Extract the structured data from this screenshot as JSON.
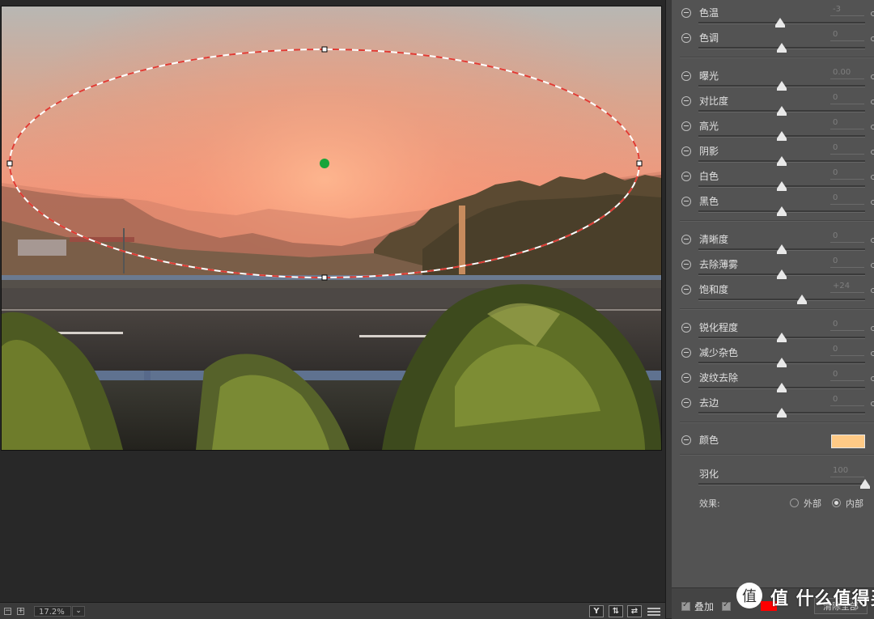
{
  "status_bar": {
    "zoom_value": "17.2%",
    "view_y_label": "Y",
    "view_compare_label": "⇅",
    "view_swap_label": "⇄"
  },
  "adjustments": {
    "groups": [
      [
        {
          "label": "色温",
          "value": "-3",
          "level": 0.49
        },
        {
          "label": "色调",
          "value": "0",
          "level": 0.5
        }
      ],
      [
        {
          "label": "曝光",
          "value": "0.00",
          "level": 0.5
        },
        {
          "label": "对比度",
          "value": "0",
          "level": 0.5
        },
        {
          "label": "高光",
          "value": "0",
          "level": 0.5
        },
        {
          "label": "阴影",
          "value": "0",
          "level": 0.5
        },
        {
          "label": "白色",
          "value": "0",
          "level": 0.5
        },
        {
          "label": "黑色",
          "value": "0",
          "level": 0.5
        }
      ],
      [
        {
          "label": "清晰度",
          "value": "0",
          "level": 0.5
        },
        {
          "label": "去除薄雾",
          "value": "0",
          "level": 0.5
        },
        {
          "label": "饱和度",
          "value": "+24",
          "level": 0.62
        }
      ],
      [
        {
          "label": "锐化程度",
          "value": "0",
          "level": 0.5
        },
        {
          "label": "减少杂色",
          "value": "0",
          "level": 0.5
        },
        {
          "label": "波纹去除",
          "value": "0",
          "level": 0.5
        },
        {
          "label": "去边",
          "value": "0",
          "level": 0.5
        }
      ]
    ],
    "color_label": "颜色",
    "color_value": "#ffca86",
    "feather": {
      "label": "羽化",
      "value": "100",
      "level": 1.0
    },
    "effect": {
      "label": "效果:",
      "options": [
        "外部",
        "内部"
      ],
      "selected": "内部"
    }
  },
  "bottom": {
    "overlay_label": "叠加",
    "clear_all_label": "清除全部"
  },
  "watermark": {
    "text": "值 什么值得买"
  },
  "colors": {
    "panel_bg": "#535353",
    "mask_line_red": "#e03a32",
    "center_pin": "#18a43a"
  }
}
